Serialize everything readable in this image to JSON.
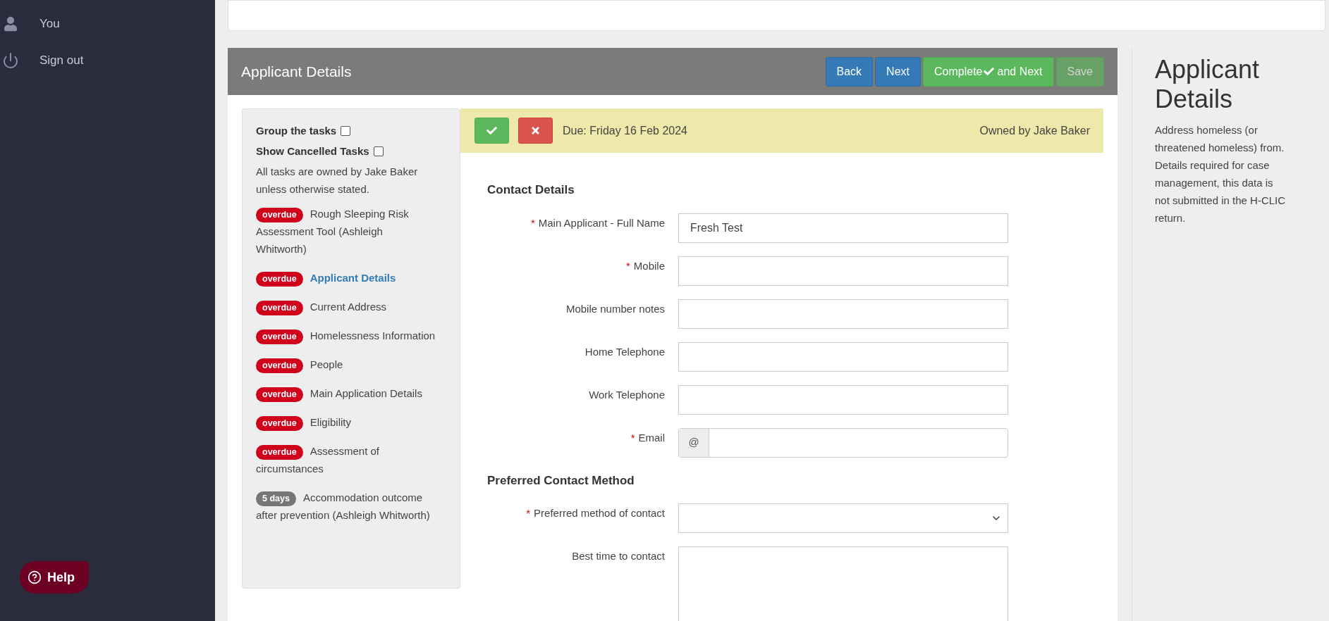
{
  "sidebar": {
    "items": [
      {
        "label": "You",
        "kind": "user"
      },
      {
        "label": "Sign out",
        "kind": "power"
      }
    ],
    "help_button": "Help"
  },
  "panel": {
    "title": "Applicant Details",
    "buttons": [
      {
        "label": "Back",
        "kind": "primary",
        "disabled": false
      },
      {
        "label": "Next",
        "kind": "primary",
        "disabled": false
      },
      {
        "label": "Complete",
        "label_after": "and Next",
        "kind": "success",
        "disabled": false
      },
      {
        "label": "Save",
        "kind": "success",
        "disabled": true
      }
    ]
  },
  "task_list": {
    "options": [
      {
        "label": "Group the tasks",
        "checked": false
      },
      {
        "label": "Show Cancelled Tasks",
        "checked": false
      }
    ],
    "note": "All tasks are owned by Jake Baker unless otherwise stated.",
    "tasks": [
      {
        "badge": "overdue",
        "overdue": true,
        "title": "Rough Sleeping Risk Assessment Tool (Ashleigh Whitworth)",
        "selected": false
      },
      {
        "badge": "overdue",
        "overdue": true,
        "title": "Applicant Details",
        "selected": true
      },
      {
        "badge": "overdue",
        "overdue": true,
        "title": "Current Address",
        "selected": false
      },
      {
        "badge": "overdue",
        "overdue": true,
        "title": "Homelessness Information",
        "selected": false
      },
      {
        "badge": "overdue",
        "overdue": true,
        "title": "People",
        "selected": false
      },
      {
        "badge": "overdue",
        "overdue": true,
        "title": "Main Application Details",
        "selected": false
      },
      {
        "badge": "overdue",
        "overdue": true,
        "title": "Eligibility",
        "selected": false
      },
      {
        "badge": "overdue",
        "overdue": true,
        "title": "Assessment of circumstances",
        "selected": false
      },
      {
        "badge": "5 days",
        "overdue": false,
        "title": "Accommodation outcome after prevention (Ashleigh Whitworth)",
        "selected": false
      }
    ]
  },
  "task_bar": {
    "due": "Due: Friday 16 Feb 2024",
    "owner": "Owned by Jake Baker"
  },
  "form": {
    "sections": [
      {
        "heading": "Contact Details",
        "fields": [
          {
            "label": "Main Applicant - Full Name",
            "required_mark": "*",
            "kind": "text",
            "value": "Fresh Test"
          },
          {
            "label": "Mobile",
            "required_mark": "*",
            "kind": "text"
          },
          {
            "label": "Mobile number notes",
            "kind": "text"
          },
          {
            "label": "Home Telephone",
            "kind": "text"
          },
          {
            "label": "Work Telephone",
            "kind": "text"
          },
          {
            "label": "Email",
            "required_mark": "*",
            "kind": "email",
            "addon": "@"
          }
        ]
      },
      {
        "heading": "Preferred Contact Method",
        "fields": [
          {
            "label": "Preferred method of contact",
            "required_mark": "*",
            "kind": "select"
          },
          {
            "label": "Best time to contact",
            "kind": "textarea"
          }
        ]
      }
    ]
  },
  "help_panel": {
    "title": "Applicant Details",
    "text": "Address homeless (or threatened homeless) from. Details required for case management, this data is not submitted in the H-CLIC return."
  }
}
